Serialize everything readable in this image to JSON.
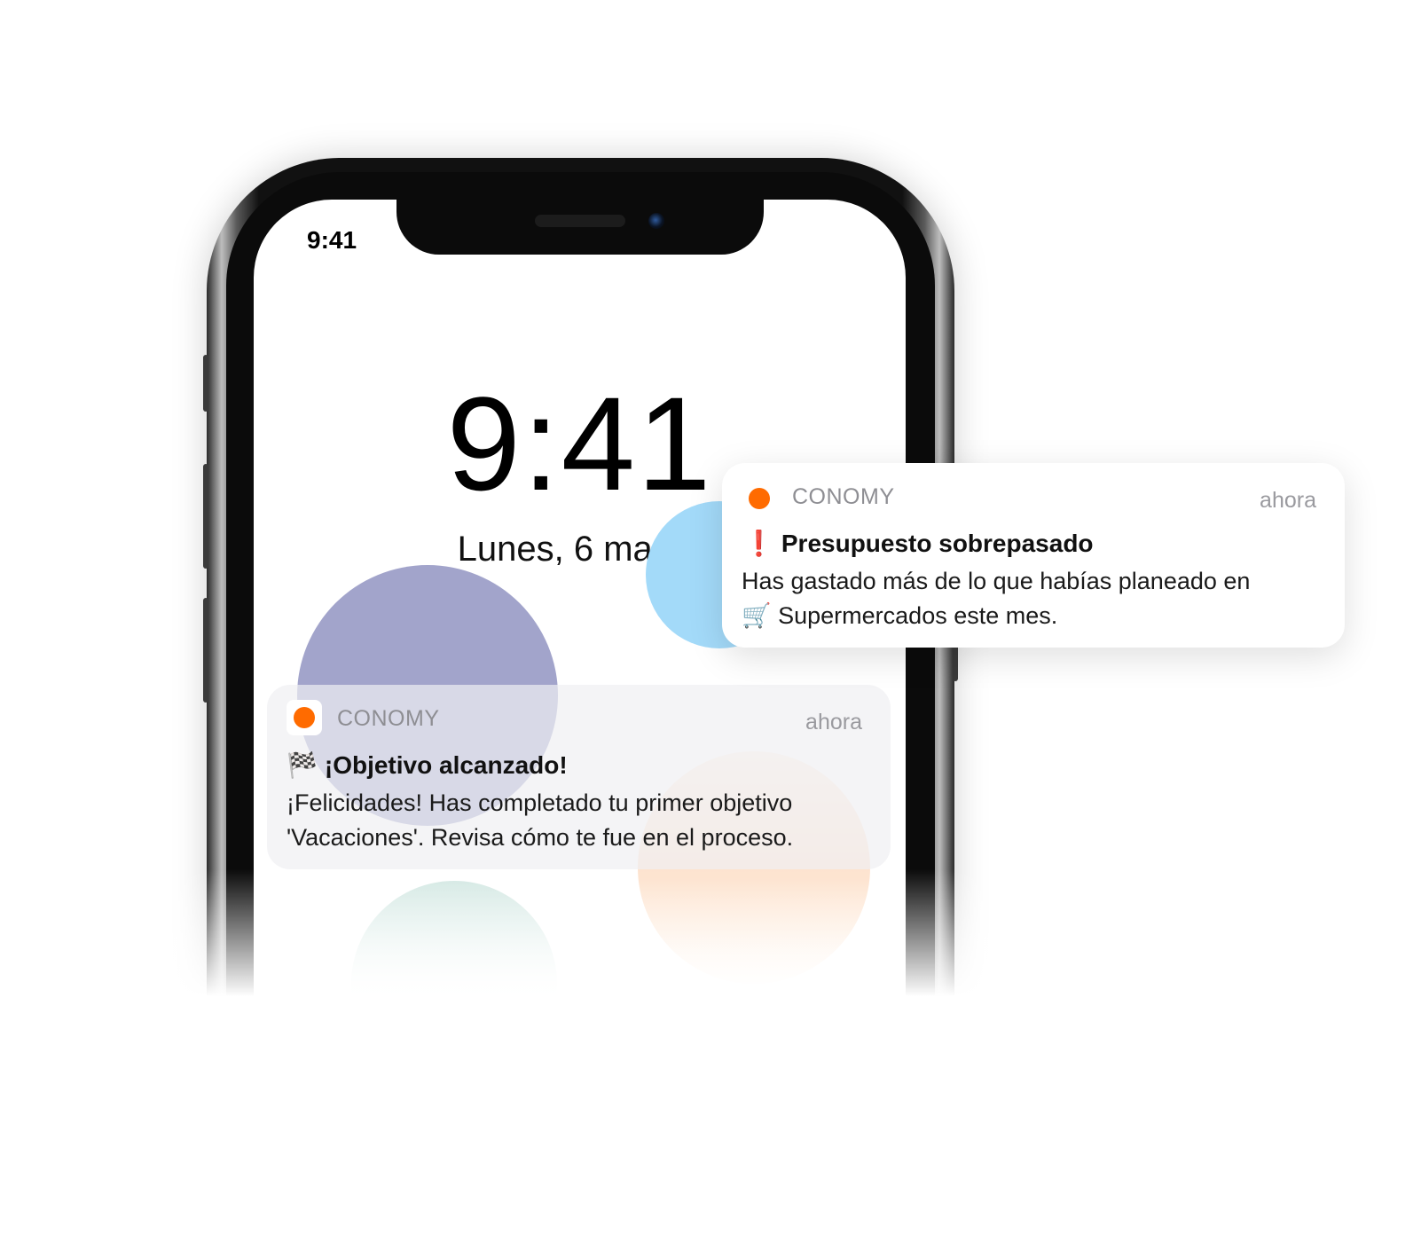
{
  "lock_screen": {
    "status_time": "9:41",
    "clock": "9:41",
    "date": "Lunes, 6 marzo"
  },
  "notifications": [
    {
      "app": "CONOMY",
      "time": "ahora",
      "icon_color": "#ff6b00",
      "title_emoji": "❗",
      "title": "Presupuesto sobrepasado",
      "body_line1": "Has gastado más de lo que habías planeado en",
      "body_line2": "🛒 Supermercados este mes."
    },
    {
      "app": "CONOMY",
      "time": "ahora",
      "icon_color": "#ff6b00",
      "title_emoji": "🏁",
      "title": "¡Objetivo alcanzado!",
      "body_line1": "¡Felicidades! Has completado tu primer objetivo",
      "body_line2": "'Vacaciones'. Revisa cómo te fue en el proceso."
    }
  ],
  "colors": {
    "accent": "#ff6b00",
    "bubble_purple": "#a2a4cb",
    "bubble_blue": "#a3daf9",
    "bubble_peach": "#fde2cd",
    "bubble_mint": "#d3e8e3"
  }
}
